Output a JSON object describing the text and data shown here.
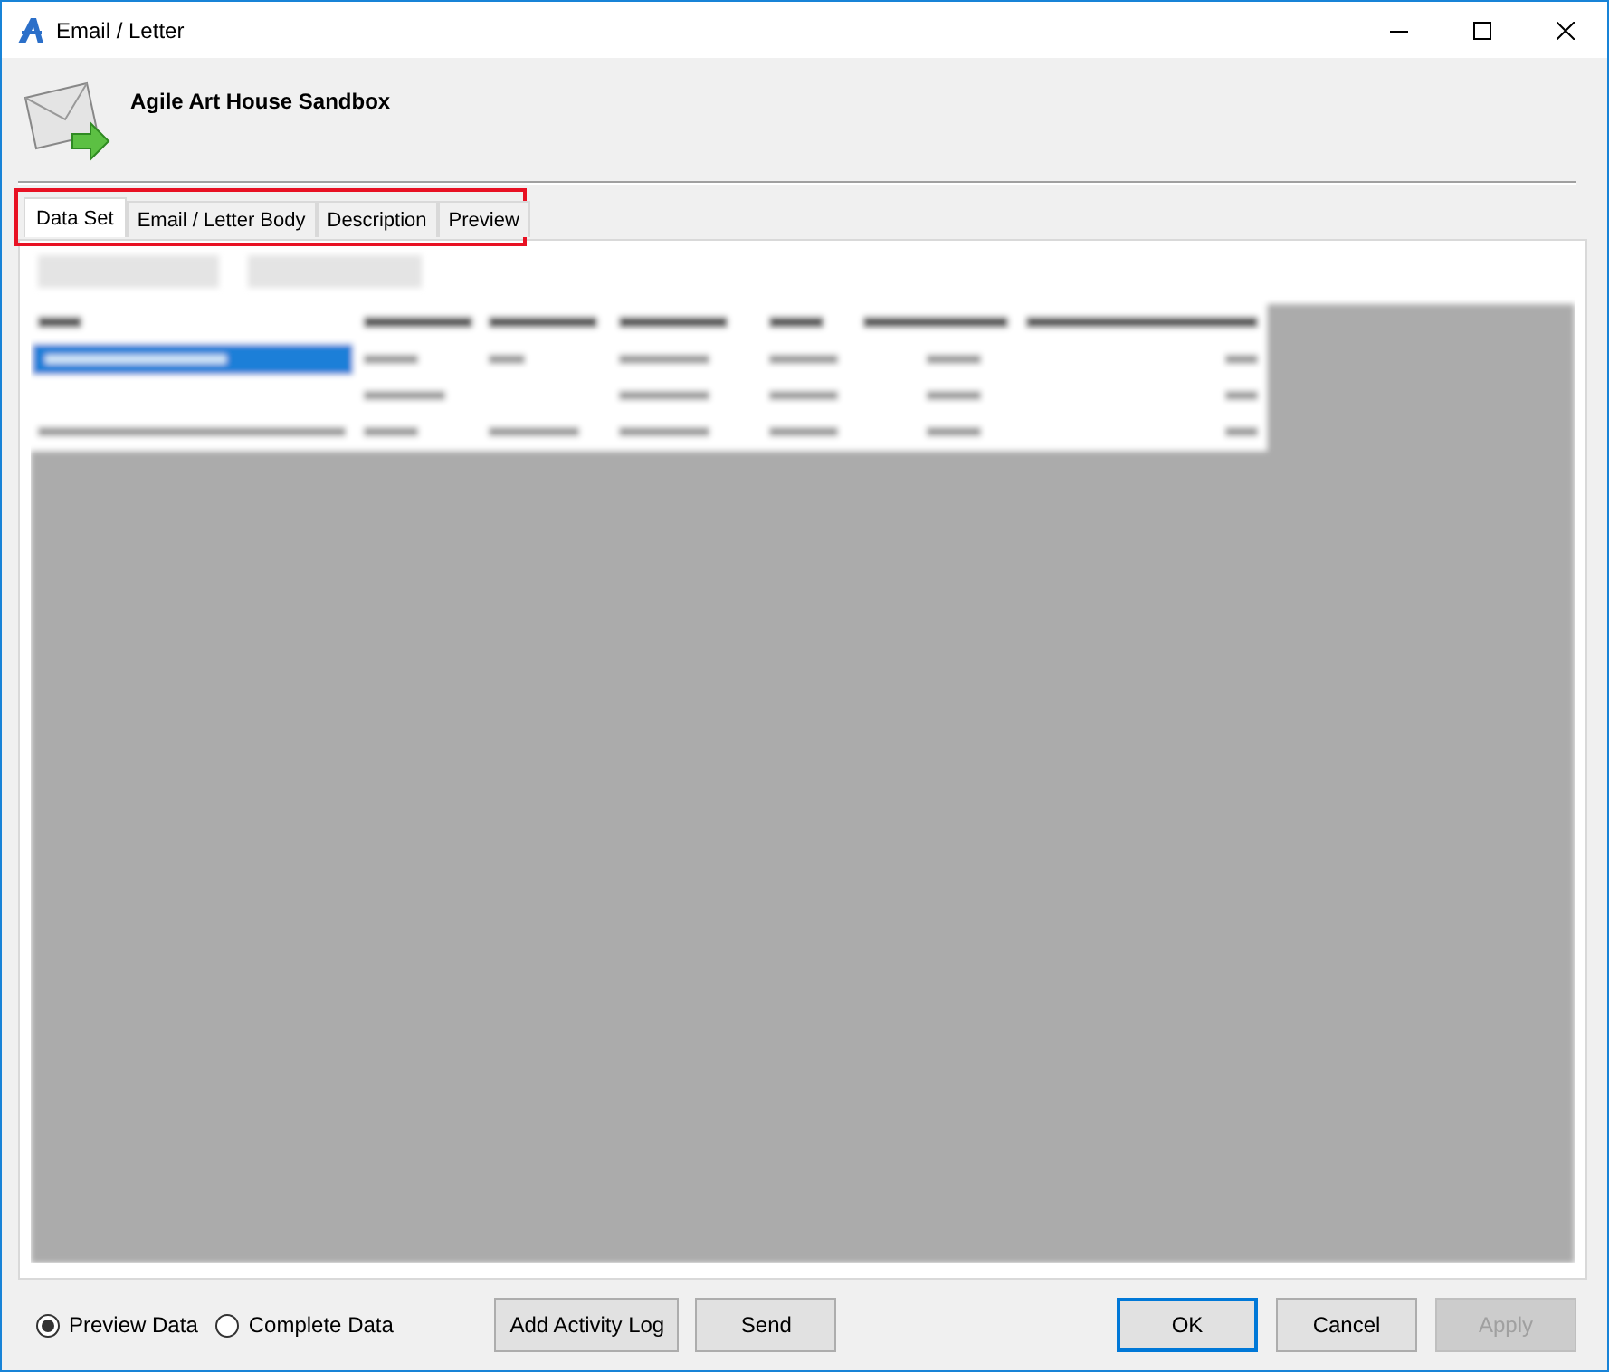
{
  "window": {
    "title": "Email / Letter"
  },
  "header": {
    "title": "Agile Art House Sandbox"
  },
  "tabs": [
    {
      "label": "Data Set",
      "selected": true
    },
    {
      "label": "Email / Letter Body",
      "selected": false
    },
    {
      "label": "Description",
      "selected": false
    },
    {
      "label": "Preview",
      "selected": false
    }
  ],
  "data_options": [
    {
      "label": "Preview Data",
      "selected": true
    },
    {
      "label": "Complete Data",
      "selected": false
    }
  ],
  "actions": [
    "Add Activity Log",
    "Send"
  ],
  "dialog_buttons": [
    {
      "label": "OK",
      "default": true,
      "disabled": false
    },
    {
      "label": "Cancel",
      "default": false,
      "disabled": false
    },
    {
      "label": "Apply",
      "default": false,
      "disabled": true
    }
  ]
}
